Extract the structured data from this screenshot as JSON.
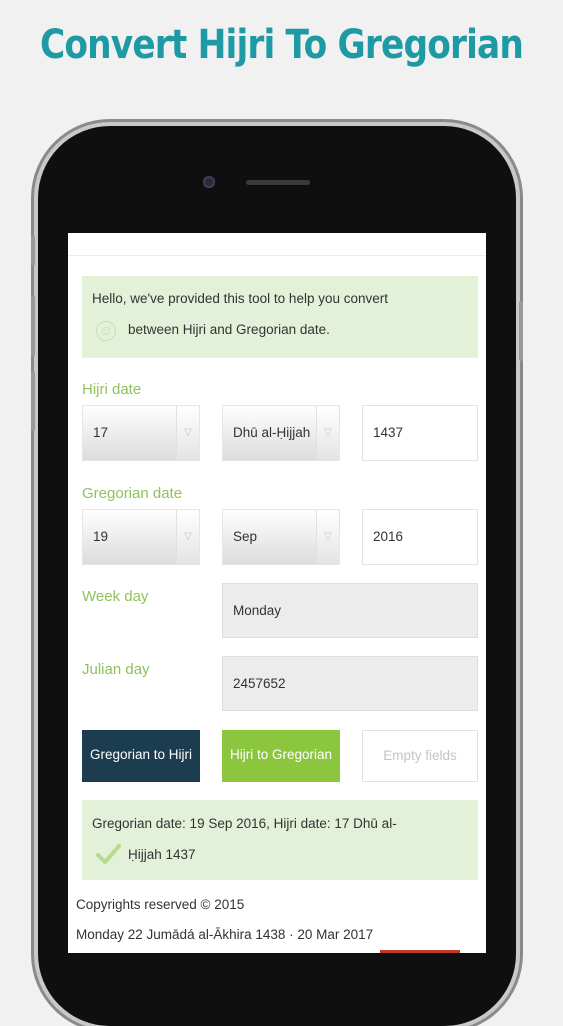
{
  "headline": "Convert Hijri To Gregorian",
  "notice": {
    "line1": "Hello, we've provided this tool to help you convert",
    "line2": "between Hijri and Gregorian date."
  },
  "hijri": {
    "label": "Hijri date",
    "day": "17",
    "month": "Dhū al-Ḥijjah",
    "year": "1437"
  },
  "gregorian": {
    "label": "Gregorian date",
    "day": "19",
    "month": "Sep",
    "year": "2016"
  },
  "weekday": {
    "label": "Week day",
    "value": "Monday"
  },
  "julian": {
    "label": "Julian day",
    "value": "2457652"
  },
  "buttons": {
    "to_hijri": "Gregorian to Hijri",
    "to_gregorian": "Hijri to Gregorian",
    "clear": "Empty fields"
  },
  "result": {
    "line1": "Gregorian date: 19 Sep 2016, Hijri date: 17 Dhū al-",
    "line2": "Ḥijjah 1437"
  },
  "footer": {
    "copyright": "Copyrights reserved © 2015",
    "today": "Monday 22 Jumādá al-Ākhira 1438 · 20 Mar 2017"
  },
  "colors": {
    "headline": "#1e9aa4",
    "label_green": "#8ec25a",
    "btn_dark": "#1c3d4f",
    "btn_green": "#8cc63f",
    "notice_bg": "#e4f1d9"
  }
}
